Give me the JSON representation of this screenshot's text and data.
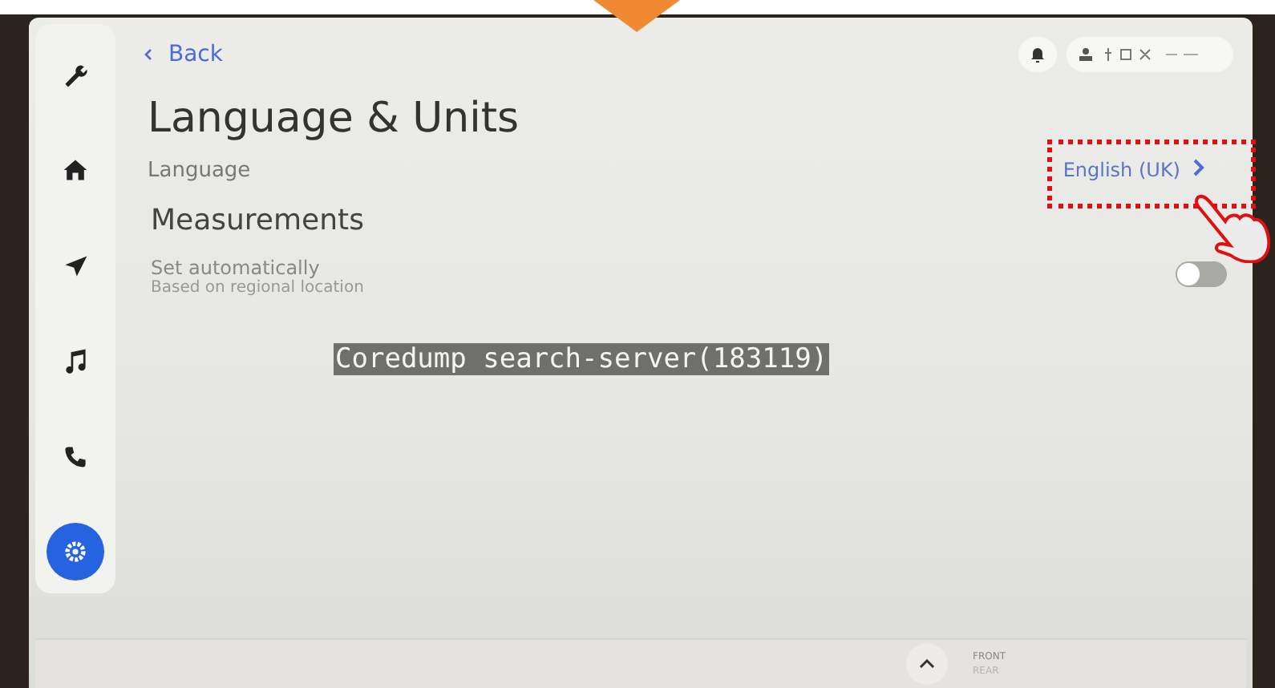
{
  "sidebar": {
    "items": [
      {
        "selected": false
      },
      {
        "selected": false
      },
      {
        "selected": false
      },
      {
        "selected": false
      },
      {
        "selected": false
      },
      {
        "selected": true
      }
    ]
  },
  "back": "Back",
  "title": "Language & Units",
  "language": {
    "label": "Language",
    "value": "English (UK)"
  },
  "section": "Measurements",
  "auto": {
    "label": "Set automatically",
    "description": "Based on regional location",
    "on": false
  },
  "error_banner": "Coredump search-server(183119)",
  "bottom_bar": {
    "front": "FRONT",
    "rear": "REAR"
  }
}
